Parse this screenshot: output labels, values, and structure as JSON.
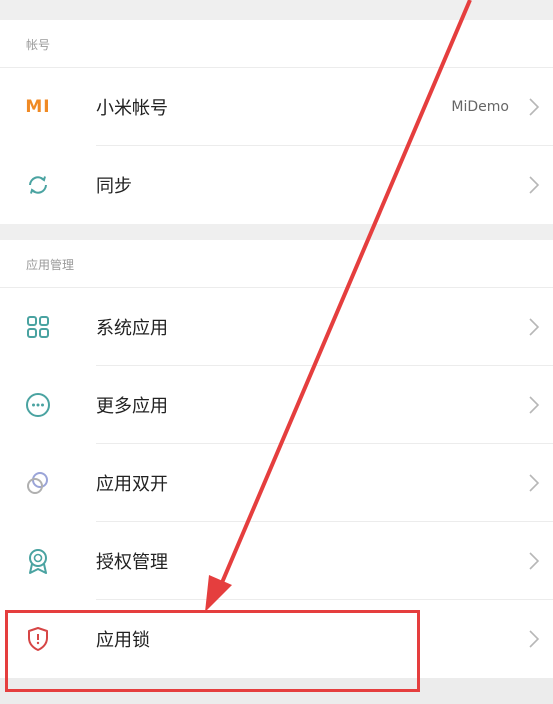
{
  "sections": [
    {
      "header": "帐号",
      "items": [
        {
          "icon": "mi-logo-icon",
          "label": "小米帐号",
          "value": "MiDemo"
        },
        {
          "icon": "sync-icon",
          "label": "同步",
          "value": ""
        }
      ]
    },
    {
      "header": "应用管理",
      "items": [
        {
          "icon": "grid-apps-icon",
          "label": "系统应用"
        },
        {
          "icon": "more-apps-icon",
          "label": "更多应用"
        },
        {
          "icon": "dual-apps-icon",
          "label": "应用双开"
        },
        {
          "icon": "permission-badge-icon",
          "label": "授权管理"
        },
        {
          "icon": "shield-lock-icon",
          "label": "应用锁"
        }
      ]
    }
  ],
  "mi_logo_text": "MI",
  "colors": {
    "accent_teal": "#4aa3a1",
    "mi_orange": "#f08a24",
    "highlight_red": "#e53e3e",
    "lock_red": "#d64545"
  }
}
